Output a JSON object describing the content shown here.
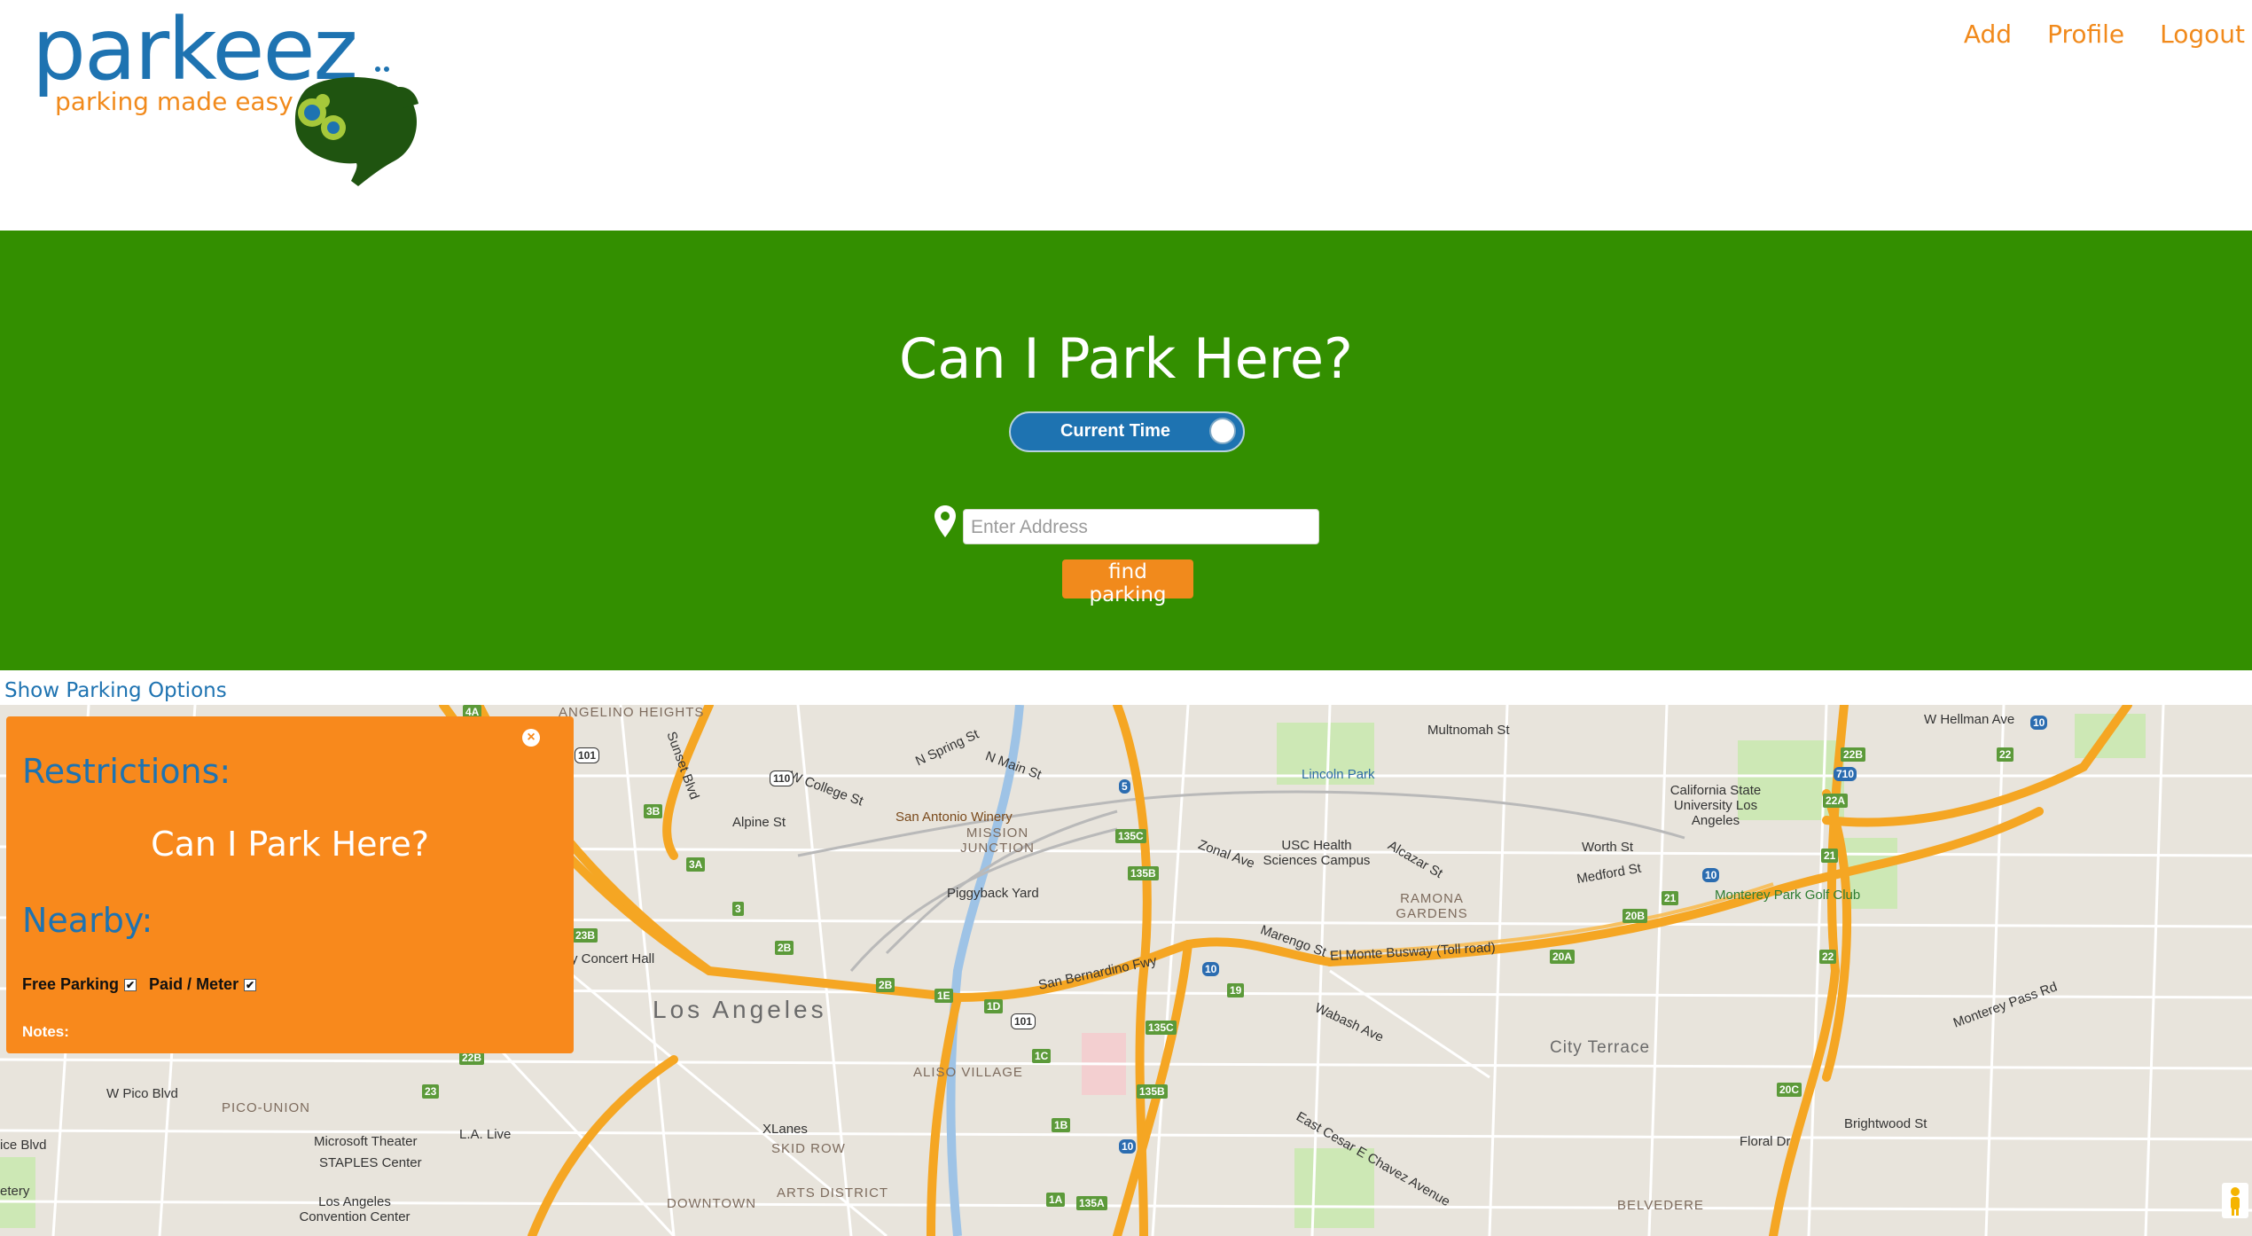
{
  "header": {
    "logo_word": "parkeez",
    "logo_tagline": "parking made easy",
    "nav": [
      "Add",
      "Profile",
      "Logout"
    ]
  },
  "hero": {
    "title": "Can I Park Here?",
    "toggle_label": "Current Time",
    "address_placeholder": "Enter Address",
    "find_button": "find parking"
  },
  "show_options": "Show Parking Options",
  "panel": {
    "restrictions_heading": "Restrictions:",
    "title": "Can I Park Here?",
    "nearby_heading": "Nearby:",
    "filters": [
      {
        "label": "Free Parking",
        "checked": true
      },
      {
        "label": "Paid / Meter",
        "checked": true
      }
    ],
    "notes_label": "Notes:"
  },
  "map": {
    "labels": {
      "los_angeles": "Los Angeles",
      "city_terrace": "City Terrace",
      "pico_union": "PICO-UNION",
      "skid_row": "SKID ROW",
      "arts_district": "ARTS DISTRICT",
      "downtown": "DOWNTOWN",
      "aliso_village": "ALISO VILLAGE",
      "mission_junction": "MISSION JUNCTION",
      "ramona_gardens": "RAMONA GARDENS",
      "belvedere": "BELVEDERE",
      "echo_park": "ANGELINO HEIGHTS",
      "lincoln_park": "Lincoln Park",
      "usc_health": "USC Health Sciences Campus",
      "cal_state": "California State University Los Angeles",
      "monterey_park_golf": "Monterey Park Golf Club",
      "san_antonio_winery": "San Antonio Winery",
      "piggyback_yard": "Piggyback Yard",
      "concert_hall": "y Concert Hall",
      "microsoft_theater": "Microsoft Theater",
      "staples_center": "STAPLES Center",
      "la_live": "L.A. Live",
      "convention_center": "Los Angeles Convention Center",
      "xlanes": "XLanes",
      "el_monte_busway": "El Monte Busway (Toll road)",
      "san_bernardino_fwy": "San Bernardino Fwy",
      "sunset_blvd": "Sunset Blvd",
      "w_pico_blvd": "W Pico Blvd",
      "multnomah": "Multnomah St",
      "w_hellman": "W Hellman Ave",
      "zonal": "Zonal Ave",
      "marengo": "Marengo St",
      "wabash": "Wabash Ave",
      "cesar_chavez": "East Cesar E Chavez Avenue",
      "brightwood": "Brightwood St",
      "monterey_pass": "Monterey Pass Rd",
      "n_main": "N Main St",
      "alpine": "Alpine St",
      "w_college": "W College St",
      "n_spring": "N Spring St",
      "worth": "Worth St",
      "medford": "Medford St",
      "alcazar": "Alcazar St",
      "floral": "Floral Dr",
      "ice_blvd": "ice Blvd",
      "etery": "etery"
    },
    "shields": [
      "4A",
      "3B",
      "3A",
      "3",
      "2B",
      "2B",
      "23B",
      "22B",
      "23",
      "110",
      "101",
      "101",
      "5",
      "10",
      "10",
      "10",
      "10",
      "710",
      "135C",
      "135B",
      "135C",
      "135B",
      "1E",
      "1D",
      "1C",
      "1B",
      "1A",
      "135A",
      "19",
      "20A",
      "20B",
      "20C",
      "21",
      "21",
      "22",
      "22A",
      "22B",
      "22"
    ]
  },
  "colors": {
    "brand_blue": "#1e73b1",
    "brand_orange": "#f18a1c",
    "hero_green": "#338f00",
    "panel_orange": "#f8891c",
    "freeway": "#f5a623"
  }
}
